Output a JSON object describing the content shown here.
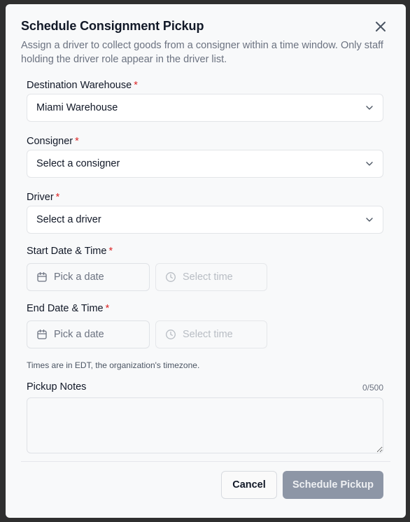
{
  "dialog": {
    "title": "Schedule Consignment Pickup",
    "subtitle": "Assign a driver to collect goods from a consigner within a time window. Only staff holding the driver role appear in the driver list."
  },
  "fields": {
    "destination": {
      "label": "Destination Warehouse",
      "value": "Miami Warehouse"
    },
    "consigner": {
      "label": "Consigner",
      "value": "Select a consigner"
    },
    "driver": {
      "label": "Driver",
      "value": "Select a driver"
    },
    "start": {
      "label": "Start Date & Time",
      "date_placeholder": "Pick a date",
      "time_placeholder": "Select time"
    },
    "end": {
      "label": "End Date & Time",
      "date_placeholder": "Pick a date",
      "time_placeholder": "Select time"
    },
    "timezone_hint": "Times are in EDT, the organization's timezone.",
    "notes": {
      "label": "Pickup Notes",
      "counter": "0/500",
      "value": ""
    }
  },
  "required_marker": "*",
  "buttons": {
    "cancel": "Cancel",
    "submit": "Schedule Pickup"
  },
  "colors": {
    "required": "#dc2626",
    "primary_disabled": "#8d96a6",
    "backdrop": "#2f2f2f"
  },
  "icons": {
    "close": "close-icon",
    "chevron": "chevron-down-icon",
    "calendar": "calendar-icon",
    "clock": "clock-icon"
  }
}
